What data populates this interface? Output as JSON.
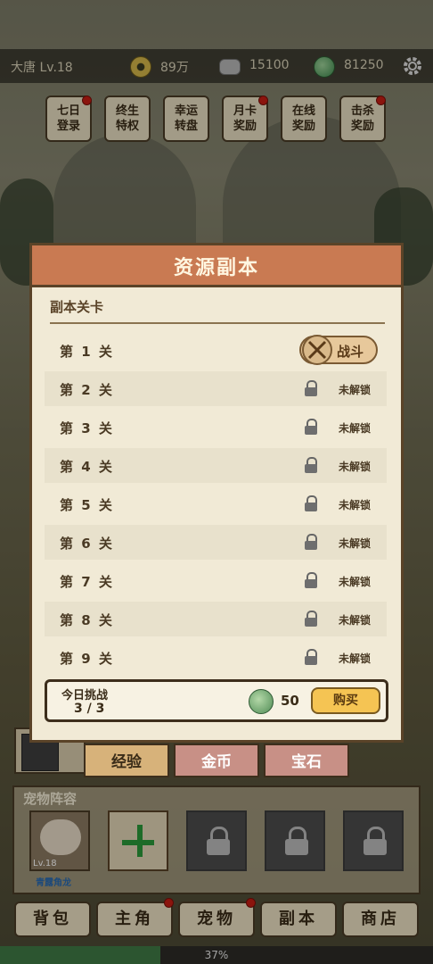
{
  "player": {
    "name": "大唐 Lv.18"
  },
  "currencies": [
    {
      "icon": "copper-coin-icon",
      "value": "89万"
    },
    {
      "icon": "silver-ingot-icon",
      "value": "15100"
    },
    {
      "icon": "jade-icon",
      "value": "81250"
    }
  ],
  "features": [
    {
      "line1": "七日",
      "line2": "登录",
      "badge": true
    },
    {
      "line1": "终生",
      "line2": "特权",
      "badge": false
    },
    {
      "line1": "幸运",
      "line2": "转盘",
      "badge": false
    },
    {
      "line1": "月卡",
      "line2": "奖励",
      "badge": true
    },
    {
      "line1": "在线",
      "line2": "奖励",
      "badge": false
    },
    {
      "line1": "击杀",
      "line2": "奖励",
      "badge": true
    }
  ],
  "modal": {
    "title": "资源副本",
    "section_title": "副本关卡",
    "levels": [
      {
        "label": "第 1 关",
        "state": "open",
        "action": "战斗"
      },
      {
        "label": "第 2 关",
        "state": "locked",
        "status": "未解锁"
      },
      {
        "label": "第 3 关",
        "state": "locked",
        "status": "未解锁"
      },
      {
        "label": "第 4 关",
        "state": "locked",
        "status": "未解锁"
      },
      {
        "label": "第 5 关",
        "state": "locked",
        "status": "未解锁"
      },
      {
        "label": "第 6 关",
        "state": "locked",
        "status": "未解锁"
      },
      {
        "label": "第 7 关",
        "state": "locked",
        "status": "未解锁"
      },
      {
        "label": "第 8 关",
        "state": "locked",
        "status": "未解锁"
      },
      {
        "label": "第 9 关",
        "state": "locked",
        "status": "未解锁"
      }
    ],
    "challenge": {
      "label": "今日挑战",
      "count": "3 / 3",
      "price": "50",
      "buy_label": "购买"
    }
  },
  "dungeon_tabs": [
    {
      "label": "经验",
      "color": "#d7b27a",
      "text_color": "#3a2c18"
    },
    {
      "label": "金币",
      "color": "#c89086",
      "text_color": "#ffffff"
    },
    {
      "label": "宝石",
      "color": "#c89086",
      "text_color": "#ffffff"
    }
  ],
  "pets": {
    "title": "宠物阵容",
    "first_pet": {
      "level": "Lv.18",
      "name": "青露角龙"
    }
  },
  "bottom_nav": [
    {
      "label": "背包",
      "badge": false
    },
    {
      "label": "主角",
      "badge": true
    },
    {
      "label": "宠物",
      "badge": true
    },
    {
      "label": "副本",
      "badge": false
    },
    {
      "label": "商店",
      "badge": false
    }
  ],
  "progress": {
    "value": 0.37,
    "label": "37%"
  }
}
